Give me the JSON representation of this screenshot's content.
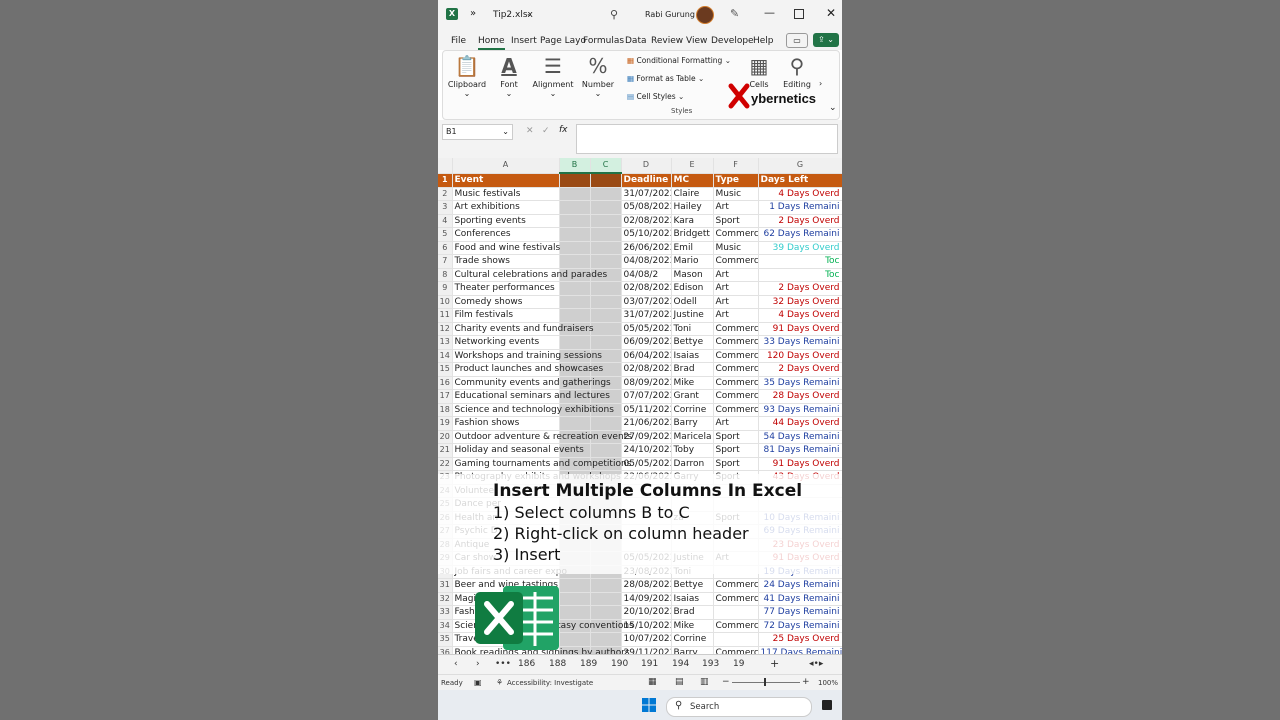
{
  "titlebar": {
    "autosave_icon": "excel-app-icon",
    "filename": "Tip2.xlsx",
    "user": "Rabi Gurung",
    "expand": "»"
  },
  "menu": {
    "tabs": [
      "File",
      "Home",
      "Insert",
      "Page Layo",
      "Formulas",
      "Data",
      "Review",
      "View",
      "Develope",
      "Help"
    ],
    "active": "Home"
  },
  "ribbon": {
    "clipboard": "Clipboard",
    "font": "Font",
    "alignment": "Alignment",
    "number": "Number",
    "conditional": "Conditional Formatting",
    "format_table": "Format as Table",
    "cell_styles": "Cell Styles",
    "styles": "Styles",
    "cells": "Cells",
    "editing": "Editing"
  },
  "formula": {
    "namebox": "B1",
    "fx": "fx"
  },
  "brand": {
    "text": "ybernetics"
  },
  "columns": [
    "A",
    "B",
    "C",
    "D",
    "E",
    "F",
    "G"
  ],
  "header": {
    "event": "Event",
    "deadline": "Deadline",
    "mc": "MC",
    "type": "Type",
    "days": "Days Left"
  },
  "rows": [
    {
      "n": "2",
      "event": "Music festivals",
      "deadline": "31/07/2023",
      "mc": "Claire",
      "type": "Music",
      "days": "4 Days Overd",
      "status": "over"
    },
    {
      "n": "3",
      "event": "Art exhibitions",
      "deadline": "05/08/2023",
      "mc": "Hailey",
      "type": "Art",
      "days": "1 Days Remaini",
      "status": "rem"
    },
    {
      "n": "4",
      "event": "Sporting events",
      "deadline": "02/08/2023",
      "mc": "Kara",
      "type": "Sport",
      "days": "2 Days Overd",
      "status": "over"
    },
    {
      "n": "5",
      "event": "Conferences",
      "deadline": "05/10/2023",
      "mc": "Bridgett",
      "type": "Commerci",
      "days": "62 Days Remaini",
      "status": "rem"
    },
    {
      "n": "6",
      "event": "Food and wine festivals",
      "deadline": "26/06/2023",
      "mc": "Emil",
      "type": "Music",
      "days": "39 Days Overd",
      "status": "cyan"
    },
    {
      "n": "7",
      "event": "Trade shows",
      "deadline": "04/08/2023",
      "mc": "Mario",
      "type": "Commerci",
      "days": "Toc",
      "status": "today"
    },
    {
      "n": "8",
      "event": "Cultural celebrations and parades",
      "deadline": "04/08/2",
      "mc": "Mason",
      "type": "Art",
      "days": "Toc",
      "status": "today"
    },
    {
      "n": "9",
      "event": "Theater performances",
      "deadline": "02/08/2023",
      "mc": "Edison",
      "type": "Art",
      "days": "2 Days Overd",
      "status": "over"
    },
    {
      "n": "10",
      "event": "Comedy shows",
      "deadline": "03/07/2023",
      "mc": "Odell",
      "type": "Art",
      "days": "32 Days Overd",
      "status": "over"
    },
    {
      "n": "11",
      "event": "Film festivals",
      "deadline": "31/07/2023",
      "mc": "Justine",
      "type": "Art",
      "days": "4 Days Overd",
      "status": "over"
    },
    {
      "n": "12",
      "event": "Charity events and fundraisers",
      "deadline": "05/05/2023",
      "mc": "Toni",
      "type": "Commercia",
      "days": "91 Days Overd",
      "status": "over"
    },
    {
      "n": "13",
      "event": "Networking events",
      "deadline": "06/09/2023",
      "mc": "Bettye",
      "type": "Commercia",
      "days": "33 Days Remaini",
      "status": "rem"
    },
    {
      "n": "14",
      "event": "Workshops and training sessions",
      "deadline": "06/04/2023",
      "mc": "Isaias",
      "type": "Commercia",
      "days": "120 Days Overd",
      "status": "over"
    },
    {
      "n": "15",
      "event": "Product launches and showcases",
      "deadline": "02/08/2023",
      "mc": "Brad",
      "type": "Commercia",
      "days": "2 Days Overd",
      "status": "over"
    },
    {
      "n": "16",
      "event": "Community events and gatherings",
      "deadline": "08/09/2023",
      "mc": "Mike",
      "type": "Commercia",
      "days": "35 Days Remaini",
      "status": "rem"
    },
    {
      "n": "17",
      "event": "Educational seminars and lectures",
      "deadline": "07/07/2023",
      "mc": "Grant",
      "type": "Commercia",
      "days": "28 Days Overd",
      "status": "over"
    },
    {
      "n": "18",
      "event": "Science and technology exhibitions",
      "deadline": "05/11/2023",
      "mc": "Corrine",
      "type": "Commercia",
      "days": "93 Days Remaini",
      "status": "rem"
    },
    {
      "n": "19",
      "event": "Fashion shows",
      "deadline": "21/06/2023",
      "mc": "Barry",
      "type": "Art",
      "days": "44 Days Overd",
      "status": "over"
    },
    {
      "n": "20",
      "event": "Outdoor adventure & recreation events",
      "deadline": "27/09/2023",
      "mc": "Maricela",
      "type": "Sport",
      "days": "54 Days Remaini",
      "status": "rem"
    },
    {
      "n": "21",
      "event": "Holiday and seasonal events",
      "deadline": "24/10/2023",
      "mc": "Toby",
      "type": "Sport",
      "days": "81 Days Remaini",
      "status": "rem"
    },
    {
      "n": "22",
      "event": "Gaming tournaments and competitions",
      "deadline": "05/05/2023",
      "mc": "Darron",
      "type": "Sport",
      "days": "91 Days Overd",
      "status": "over"
    },
    {
      "n": "23",
      "event": "Photography exhibits and workshops",
      "deadline": "22/06/2023",
      "mc": "Garry",
      "type": "Sport",
      "days": "43 Days Overd",
      "status": "over"
    },
    {
      "n": "24",
      "event": "Volunteer",
      "deadline": "",
      "mc": "",
      "type": "",
      "days": "",
      "status": "rem"
    },
    {
      "n": "25",
      "event": "Dance per",
      "deadline": "",
      "mc": "",
      "type": "",
      "days": "",
      "status": "over"
    },
    {
      "n": "26",
      "event": "Health an",
      "deadline": "",
      "mc": "za",
      "type": "Sport",
      "days": "10 Days Remaini",
      "status": "rem"
    },
    {
      "n": "27",
      "event": "Psychic D",
      "deadline": "",
      "mc": "",
      "type": "",
      "days": "69 Days Remaini",
      "status": "rem"
    },
    {
      "n": "28",
      "event": "Antique",
      "deadline": "",
      "mc": "",
      "type": "",
      "days": "23 Days Overd",
      "status": "over"
    },
    {
      "n": "29",
      "event": "Car show",
      "deadline": "05/05/2023",
      "mc": "Justine",
      "type": "Art",
      "days": "91 Days Overd",
      "status": "over"
    },
    {
      "n": "30",
      "event": "Job fairs and career expo",
      "deadline": "23/08/2023",
      "mc": "Toni",
      "type": "",
      "days": "19 Days Remaini",
      "status": "rem"
    },
    {
      "n": "31",
      "event": "Beer and wine tastings",
      "deadline": "28/08/2023",
      "mc": "Bettye",
      "type": "Commercia",
      "days": "24 Days Remaini",
      "status": "rem"
    },
    {
      "n": "32",
      "event": "Magic",
      "deadline": "14/09/2023",
      "mc": "Isaias",
      "type": "Commercia",
      "days": "41 Days Remaini",
      "status": "rem"
    },
    {
      "n": "33",
      "event": "Fashion",
      "deadline": "20/10/2023",
      "mc": "Brad",
      "type": "",
      "days": "77 Days Remaini",
      "status": "rem"
    },
    {
      "n": "34",
      "event": "Science fiction and fantasy conventions",
      "deadline": "15/10/2023",
      "mc": "Mike",
      "type": "Commercia",
      "days": "72 Days Remaini",
      "status": "rem"
    },
    {
      "n": "35",
      "event": "Travel",
      "deadline": "10/07/2023",
      "mc": "Corrine",
      "type": "",
      "days": "25 Days Overd",
      "status": "over"
    },
    {
      "n": "36",
      "event": "Book readings and signings by authors",
      "deadline": "29/11/2023",
      "mc": "Barry",
      "type": "Commercia",
      "days": "117 Days Remaini",
      "status": "rem"
    }
  ],
  "overlay": {
    "title": "Insert Multiple Columns In Excel",
    "steps": [
      "1) Select columns B to C",
      "2) Right-click on column header",
      "3) Insert"
    ]
  },
  "sheets": [
    "186",
    "188",
    "189",
    "190",
    "191",
    "194",
    "193",
    "19"
  ],
  "status": {
    "ready": "Ready",
    "accessibility": "Accessibility: Investigate",
    "zoom": "100%"
  },
  "taskbar": {
    "search": "Search"
  },
  "colors": {
    "header": "#c55a11",
    "overdue": "#c00000",
    "remaining": "#1f3fa0",
    "today": "#00b050",
    "excel_green": "#217346"
  }
}
